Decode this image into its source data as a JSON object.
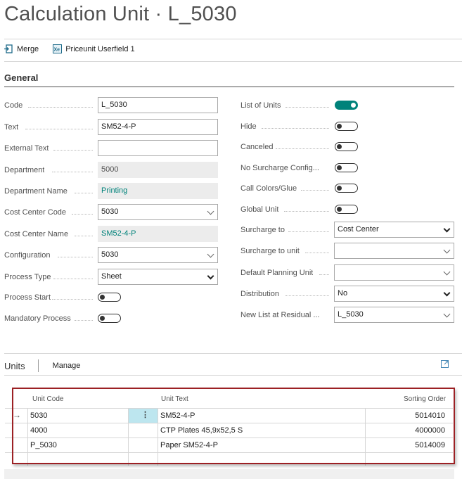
{
  "page": {
    "title": "Calculation Unit · L_5030"
  },
  "actions": [
    {
      "label": "Merge",
      "icon": "merge-icon"
    },
    {
      "label": "Priceunit Userfield 1",
      "icon": "userfield-icon"
    }
  ],
  "general": {
    "title": "General",
    "left": [
      {
        "label": "Code",
        "value": "L_5030",
        "kind": "input"
      },
      {
        "label": "Text",
        "value": "SM52-4-P",
        "kind": "input"
      },
      {
        "label": "External Text",
        "value": "",
        "kind": "input"
      },
      {
        "label": "Department",
        "value": "5000",
        "kind": "readonly"
      },
      {
        "label": "Department Name",
        "value": "Printing",
        "kind": "readonly-link"
      },
      {
        "label": "Cost Center Code",
        "value": "5030",
        "kind": "lookup"
      },
      {
        "label": "Cost Center Name",
        "value": "SM52-4-P",
        "kind": "readonly-link"
      },
      {
        "label": "Configuration",
        "value": "5030",
        "kind": "lookup"
      },
      {
        "label": "Process Type",
        "value": "Sheet",
        "kind": "select"
      },
      {
        "label": "Process Start",
        "value": false,
        "kind": "toggle"
      },
      {
        "label": "Mandatory Process",
        "value": false,
        "kind": "toggle"
      }
    ],
    "right": [
      {
        "label": "List of Units",
        "value": true,
        "kind": "toggle"
      },
      {
        "label": "Hide",
        "value": false,
        "kind": "toggle"
      },
      {
        "label": "Canceled",
        "value": false,
        "kind": "toggle"
      },
      {
        "label": "No Surcharge Config...",
        "value": false,
        "kind": "toggle"
      },
      {
        "label": "Call Colors/Glue",
        "value": false,
        "kind": "toggle"
      },
      {
        "label": "Global Unit",
        "value": false,
        "kind": "toggle"
      },
      {
        "label": "Surcharge to",
        "value": "Cost Center",
        "kind": "select"
      },
      {
        "label": "Surcharge to unit",
        "value": "",
        "kind": "lookup"
      },
      {
        "label": "Default Planning Unit",
        "value": "",
        "kind": "lookup"
      },
      {
        "label": "Distribution",
        "value": "No",
        "kind": "select"
      },
      {
        "label": "New List at Residual ...",
        "value": "L_5030",
        "kind": "lookup"
      }
    ]
  },
  "units": {
    "title": "Units",
    "manage_label": "Manage",
    "columns": [
      "Unit Code",
      "Unit Text",
      "Sorting Order"
    ],
    "rows": [
      {
        "code": "5030",
        "text": "SM52-4-P",
        "order": "5014010"
      },
      {
        "code": "4000",
        "text": "CTP Plates 45,9x52,5 S",
        "order": "4000000"
      },
      {
        "code": "P_5030",
        "text": "Paper SM52-4-P",
        "order": "5014009"
      }
    ]
  },
  "colors": {
    "accent": "#00827a",
    "selection_frame": "#9c2024",
    "row_menu_highlight": "#bde6ef"
  }
}
